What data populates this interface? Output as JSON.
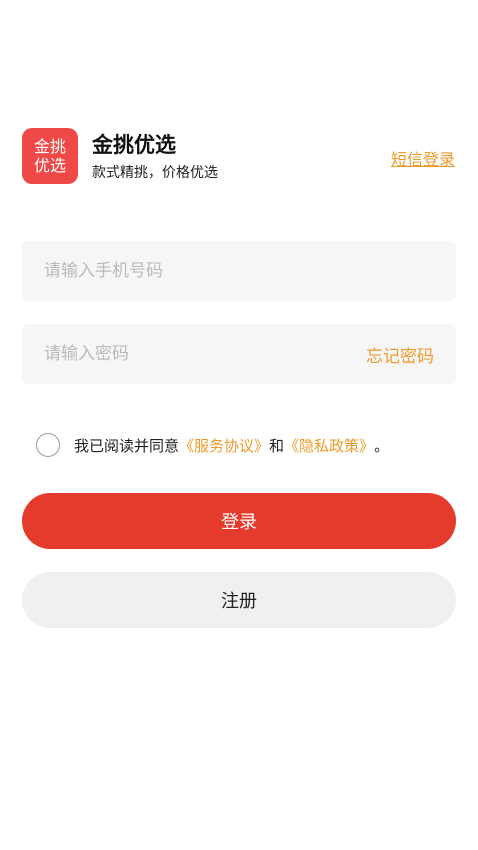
{
  "brand": {
    "logo_line1": "金挑",
    "logo_line2": "优选",
    "name": "金挑优选",
    "slogan": "款式精挑，价格优选"
  },
  "header": {
    "sms_login_label": "短信登录"
  },
  "form": {
    "phone_placeholder": "请输入手机号码",
    "password_placeholder": "请输入密码",
    "forgot_password_label": "忘记密码"
  },
  "agreement": {
    "prefix": "我已阅读并同意",
    "service_link": "《服务协议》",
    "conjunction": "和",
    "privacy_link": "《隐私政策》",
    "suffix": "。",
    "checked": false
  },
  "buttons": {
    "login_label": "登录",
    "register_label": "注册"
  },
  "colors": {
    "brand_red": "#e43b2d",
    "accent_orange": "#ef9b2b",
    "field_bg": "#f6f6f6"
  }
}
